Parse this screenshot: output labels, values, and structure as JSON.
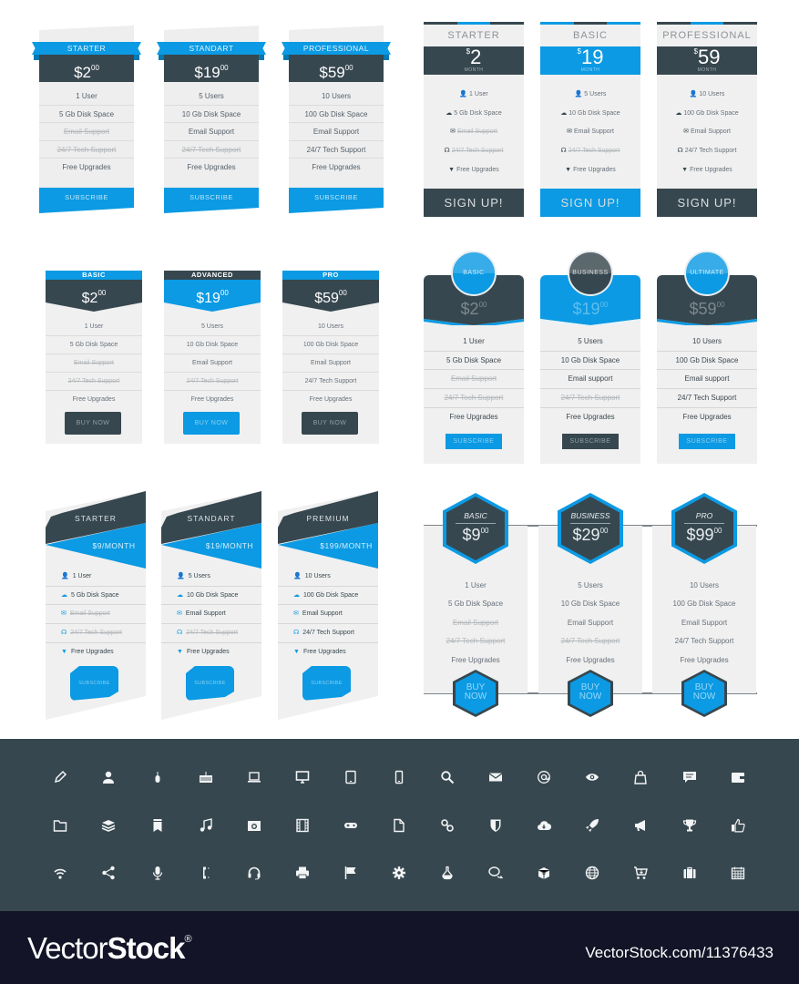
{
  "colors": {
    "dark": "#37474f",
    "blue": "#0b9ae3",
    "card_bg": "#f0f0f0",
    "panel_bg": "#37474f",
    "footer_bg": "#131427"
  },
  "set1": {
    "cards": [
      {
        "name": "STARTER",
        "price": "$2",
        "cents": "00",
        "features": [
          "1 User",
          "5 Gb Disk Space",
          "Email Support",
          "24/7 Tech Support",
          "Free Upgrades"
        ],
        "struck": [
          false,
          false,
          true,
          true,
          false
        ],
        "button": "SUBSCRIBE"
      },
      {
        "name": "STANDART",
        "price": "$19",
        "cents": "00",
        "features": [
          "5 Users",
          "10 Gb Disk Space",
          "Email Support",
          "24/7 Tech Support",
          "Free Upgrades"
        ],
        "struck": [
          false,
          false,
          false,
          true,
          false
        ],
        "button": "SUBSCRIBE"
      },
      {
        "name": "PROFESSIONAL",
        "price": "$59",
        "cents": "00",
        "features": [
          "10 Users",
          "100 Gb Disk Space",
          "Email Support",
          "24/7 Tech Support",
          "Free Upgrades"
        ],
        "struck": [
          false,
          false,
          false,
          false,
          false
        ],
        "button": "SUBSCRIBE"
      }
    ]
  },
  "set2": {
    "cards": [
      {
        "name": "STARTER",
        "currency": "$",
        "price": "2",
        "period": "MONTH",
        "theme": "dark",
        "features": [
          {
            "icon": "user-icon",
            "text": "1 User"
          },
          {
            "icon": "cloud-icon",
            "text": "5 Gb Disk Space"
          },
          {
            "icon": "mail-icon",
            "text": "Email Support"
          },
          {
            "icon": "headset-icon",
            "text": "24/7 Tech Support"
          },
          {
            "icon": "gift-icon",
            "text": "Free Upgrades"
          }
        ],
        "struck": [
          false,
          false,
          true,
          true,
          false
        ],
        "button": "SIGN UP!"
      },
      {
        "name": "BASIC",
        "currency": "$",
        "price": "19",
        "period": "MONTH",
        "theme": "blue",
        "features": [
          {
            "icon": "user-icon",
            "text": "5 Users"
          },
          {
            "icon": "cloud-icon",
            "text": "10 Gb Disk Space"
          },
          {
            "icon": "mail-icon",
            "text": "Email Support"
          },
          {
            "icon": "headset-icon",
            "text": "24/7 Tech Support"
          },
          {
            "icon": "gift-icon",
            "text": "Free Upgrades"
          }
        ],
        "struck": [
          false,
          false,
          false,
          true,
          false
        ],
        "button": "SIGN UP!"
      },
      {
        "name": "PROFESSIONAL",
        "currency": "$",
        "price": "59",
        "period": "MONTH",
        "theme": "dark",
        "features": [
          {
            "icon": "user-icon",
            "text": "10 Users"
          },
          {
            "icon": "cloud-icon",
            "text": "100 Gb Disk Space"
          },
          {
            "icon": "mail-icon",
            "text": "Email Support"
          },
          {
            "icon": "headset-icon",
            "text": "24/7 Tech Support"
          },
          {
            "icon": "gift-icon",
            "text": "Free Upgrades"
          }
        ],
        "struck": [
          false,
          false,
          false,
          false,
          false
        ],
        "button": "SIGN UP!"
      }
    ]
  },
  "set3": {
    "cards": [
      {
        "name": "BASIC",
        "price": "$2",
        "cents": "00",
        "theme": "dark",
        "features": [
          "1 User",
          "5 Gb Disk Space",
          "Email Support",
          "24/7 Tech Support",
          "Free Upgrades"
        ],
        "struck": [
          false,
          false,
          true,
          true,
          false
        ],
        "button": "BUY NOW"
      },
      {
        "name": "ADVANCED",
        "price": "$19",
        "cents": "00",
        "theme": "blue",
        "features": [
          "5 Users",
          "10 Gb Disk Space",
          "Email Support",
          "24/7 Tech Support",
          "Free Upgrades"
        ],
        "struck": [
          false,
          false,
          false,
          true,
          false
        ],
        "button": "BUY NOW"
      },
      {
        "name": "PRO",
        "price": "$59",
        "cents": "00",
        "theme": "dark",
        "features": [
          "10 Users",
          "100 Gb Disk Space",
          "Email Support",
          "24/7 Tech Support",
          "Free Upgrades"
        ],
        "struck": [
          false,
          false,
          false,
          false,
          false
        ],
        "button": "BUY NOW"
      }
    ]
  },
  "set4": {
    "cards": [
      {
        "name": "BASIC",
        "price": "$2",
        "cents": "00",
        "theme": "dark",
        "features": [
          "1 User",
          "5 Gb Disk Space",
          "Email Support",
          "24/7 Tech Support",
          "Free Upgrades"
        ],
        "struck": [
          false,
          false,
          true,
          true,
          false
        ],
        "button": "SUBSCRIBE"
      },
      {
        "name": "BUSINESS",
        "price": "$19",
        "cents": "00",
        "theme": "blue",
        "features": [
          "5 Users",
          "10 Gb Disk Space",
          "Email support",
          "24/7 Tech Support",
          "Free Upgrades"
        ],
        "struck": [
          false,
          false,
          false,
          true,
          false
        ],
        "button": "SUBSCRIBE"
      },
      {
        "name": "ULTIMATE",
        "price": "$59",
        "cents": "00",
        "theme": "dark",
        "features": [
          "10 Users",
          "100 Gb Disk Space",
          "Email support",
          "24/7 Tech Support",
          "Free Upgrades"
        ],
        "struck": [
          false,
          false,
          false,
          false,
          false
        ],
        "button": "SUBSCRIBE"
      }
    ]
  },
  "set5": {
    "cards": [
      {
        "name": "STARTER",
        "price": "$9/MONTH",
        "features": [
          {
            "icon": "user-icon",
            "text": "1 User"
          },
          {
            "icon": "cloud-icon",
            "text": "5 Gb Disk Space"
          },
          {
            "icon": "mail-icon",
            "text": "Email Support"
          },
          {
            "icon": "headset-icon",
            "text": "24/7 Tech Support"
          },
          {
            "icon": "gift-icon",
            "text": "Free Upgrades"
          }
        ],
        "struck": [
          false,
          false,
          true,
          true,
          false
        ],
        "button": "SUBSCRIBE"
      },
      {
        "name": "STANDART",
        "price": "$19/MONTH",
        "features": [
          {
            "icon": "user-icon",
            "text": "5 Users"
          },
          {
            "icon": "cloud-icon",
            "text": "10 Gb Disk Space"
          },
          {
            "icon": "mail-icon",
            "text": "Email Support"
          },
          {
            "icon": "headset-icon",
            "text": "24/7 Tech Support"
          },
          {
            "icon": "gift-icon",
            "text": "Free Upgrades"
          }
        ],
        "struck": [
          false,
          false,
          false,
          true,
          false
        ],
        "button": "SUBSCRIBE"
      },
      {
        "name": "PREMIUM",
        "price": "$199/MONTH",
        "features": [
          {
            "icon": "user-icon",
            "text": "10 Users"
          },
          {
            "icon": "cloud-icon",
            "text": "100 Gb Disk Space"
          },
          {
            "icon": "mail-icon",
            "text": "Email Support"
          },
          {
            "icon": "headset-icon",
            "text": "24/7 Tech Support"
          },
          {
            "icon": "gift-icon",
            "text": "Free Upgrades"
          }
        ],
        "struck": [
          false,
          false,
          false,
          false,
          false
        ],
        "button": "SUBSCRIBE"
      }
    ]
  },
  "set6": {
    "cards": [
      {
        "name": "BASIC",
        "price": "$9",
        "cents": "00",
        "features": [
          "1 User",
          "5 Gb Disk Space",
          "Email Support",
          "24/7 Tech Support",
          "Free Upgrades"
        ],
        "struck": [
          false,
          false,
          true,
          true,
          false
        ],
        "button_line1": "BUY",
        "button_line2": "NOW"
      },
      {
        "name": "BUSINESS",
        "price": "$29",
        "cents": "00",
        "features": [
          "5 Users",
          "10 Gb Disk Space",
          "Email Support",
          "24/7 Tech Support",
          "Free Upgrades"
        ],
        "struck": [
          false,
          false,
          false,
          true,
          false
        ],
        "button_line1": "BUY",
        "button_line2": "NOW"
      },
      {
        "name": "PRO",
        "price": "$99",
        "cents": "00",
        "features": [
          "10 Users",
          "100 Gb Disk Space",
          "Email Support",
          "24/7 Tech Support",
          "Free Upgrades"
        ],
        "struck": [
          false,
          false,
          false,
          false,
          false
        ],
        "button_line1": "BUY",
        "button_line2": "NOW"
      }
    ]
  },
  "icons": [
    [
      "pencil-icon",
      "user-icon",
      "mouse-icon",
      "keyboard-icon",
      "laptop-icon",
      "monitor-icon",
      "tablet-icon",
      "smartphone-icon",
      "search-icon",
      "mail-icon",
      "at-icon",
      "eye-icon",
      "shopping-bag-icon",
      "chat-bubble-icon",
      "wallet-icon"
    ],
    [
      "folder-icon",
      "layers-icon",
      "bookmark-icon",
      "music-icon",
      "camera-icon",
      "film-icon",
      "gamepad-icon",
      "document-icon",
      "link-icon",
      "shield-icon",
      "cloud-download-icon",
      "rocket-icon",
      "megaphone-icon",
      "trophy-icon",
      "thumbs-up-icon"
    ],
    [
      "wifi-icon",
      "share-icon",
      "microphone-icon",
      "phone-icon",
      "headset-icon",
      "printer-icon",
      "flag-icon",
      "gear-icon",
      "flask-icon",
      "chat-bubbles-icon",
      "box-icon",
      "globe-icon",
      "cart-icon",
      "briefcase-icon",
      "calendar-icon"
    ]
  ],
  "footer": {
    "brand_light": "Vector",
    "brand_bold": "Stock",
    "brand_reg": "®",
    "url": "VectorStock.com/11376433"
  }
}
